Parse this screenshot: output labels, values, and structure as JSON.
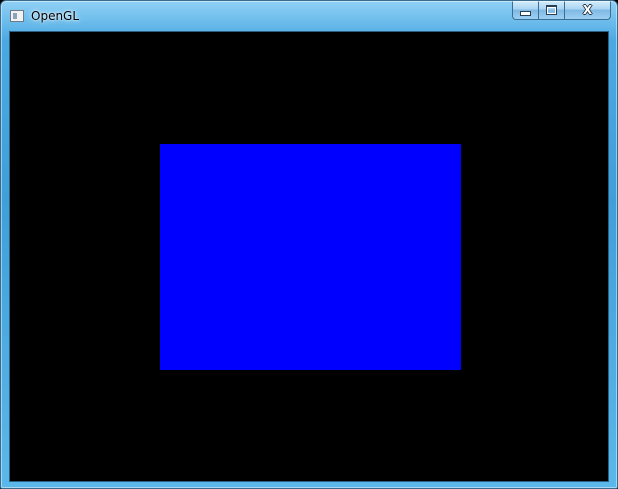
{
  "window": {
    "title": "OpenGL",
    "icons": {
      "app": "window-icon",
      "minimize": "minimize-icon",
      "maximize": "maximize-icon",
      "close": "close-icon"
    },
    "close_glyph": "X"
  },
  "canvas": {
    "background_color": "#000000",
    "shape": {
      "type": "rectangle",
      "fill_color": "#0000ff"
    }
  }
}
